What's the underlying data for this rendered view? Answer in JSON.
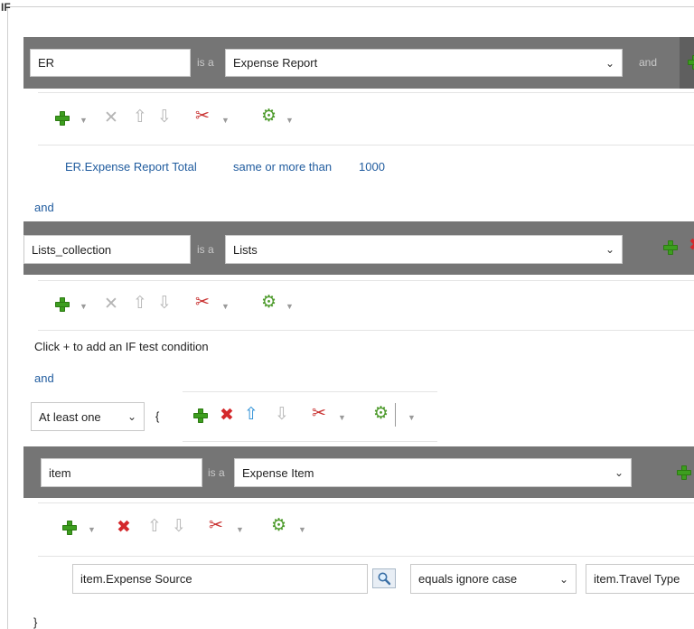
{
  "section_label": "IF",
  "block1": {
    "variable": "ER",
    "is_a": "is a",
    "type_value": "Expense Report",
    "and_label": "and",
    "condition": {
      "left": "ER.Expense Report Total",
      "operator": "same or more than",
      "right": "1000"
    }
  },
  "and_1": "and",
  "block2": {
    "variable": "Lists_collection",
    "is_a": "is a",
    "type_value": "Lists",
    "hint": "Click + to add an IF test condition"
  },
  "and_2": "and",
  "quantifier": {
    "value": "At least one",
    "brace_open": "{"
  },
  "block3": {
    "variable": "item",
    "is_a": "is a",
    "type_value": "Expense Item",
    "condition": {
      "left": "item.Expense Source",
      "operator": "equals ignore case",
      "right": "item.Travel Type"
    }
  },
  "brace_close": "}",
  "icons": {
    "add": "add-plus-icon",
    "delete": "delete-x-icon",
    "move_up": "arrow-up-icon",
    "move_down": "arrow-down-icon",
    "cut": "scissors-icon",
    "settings": "gear-icon",
    "dropdown": "chevron-down-icon",
    "search": "search-icon"
  },
  "colors": {
    "bar": "#757575",
    "link_blue": "#1f5b9e",
    "add_green": "#3d9e1f",
    "delete_red": "#d4282b"
  }
}
